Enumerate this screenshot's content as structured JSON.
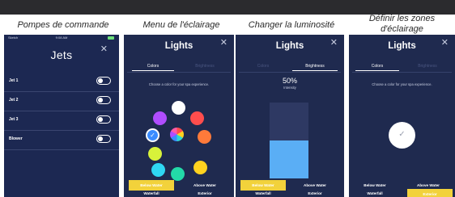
{
  "captions": {
    "jets_pumps": "Pompes de commande",
    "lighting_menu": "Menu de l'éclairage",
    "brightness": "Changer la luminosité",
    "zones": "Définir les zones d'éclairage"
  },
  "jets_screen": {
    "status_carrier": "Sketch",
    "status_time": "9:08 AM",
    "title": "Jets",
    "close_glyph": "✕",
    "items": [
      {
        "label": "Jet 1",
        "on": false
      },
      {
        "label": "Jet 2",
        "on": false
      },
      {
        "label": "Jet 3",
        "on": false
      },
      {
        "label": "Blower",
        "on": false
      }
    ]
  },
  "lights_colors_screen": {
    "title": "Lights",
    "close_glyph": "✕",
    "tabs": [
      "Colors",
      "Brightness"
    ],
    "active_tab": "Colors",
    "hint": "Choose a color for your spa experience.",
    "colors": [
      {
        "name": "white",
        "hex": "#ffffff"
      },
      {
        "name": "purple",
        "hex": "#b04dff"
      },
      {
        "name": "blue",
        "hex": "#3b8cff"
      },
      {
        "name": "color-wheel",
        "hex": "multi"
      },
      {
        "name": "red",
        "hex": "#ff4d4d"
      },
      {
        "name": "yellow-green",
        "hex": "#d8f23a"
      },
      {
        "name": "orange",
        "hex": "#ff7a3a"
      },
      {
        "name": "cyan",
        "hex": "#2fd7f3"
      },
      {
        "name": "teal",
        "hex": "#23d9a8"
      },
      {
        "name": "yellow",
        "hex": "#ffd21f"
      }
    ],
    "selected_color": "blue",
    "check_glyph": "✓",
    "zones": [
      {
        "label": "Below Water",
        "on": true
      },
      {
        "label": "Above Water",
        "on": false
      },
      {
        "label": "Waterfall",
        "on": false
      },
      {
        "label": "Exterior",
        "on": false
      }
    ]
  },
  "lights_brightness_screen": {
    "title": "Lights",
    "close_glyph": "✕",
    "tabs": [
      "Colors",
      "Brightness"
    ],
    "active_tab": "Brightness",
    "intensity_value": "50%",
    "intensity_label": "Intensity",
    "intensity_fraction": 0.5,
    "zones": [
      {
        "label": "Below Water",
        "on": true
      },
      {
        "label": "Above Water",
        "on": false
      },
      {
        "label": "Waterfall",
        "on": false
      },
      {
        "label": "Exterior",
        "on": false
      }
    ]
  },
  "lights_zones_screen": {
    "title": "Lights",
    "close_glyph": "✕",
    "tabs": [
      "Colors",
      "Brightness"
    ],
    "active_tab": "Colors",
    "hint": "Choose a color for your spa experience.",
    "check_glyph": "✓",
    "zones": [
      {
        "label": "Below Water",
        "on": false
      },
      {
        "label": "Above Water",
        "on": false
      },
      {
        "label": "Waterfall",
        "on": false
      },
      {
        "label": "Exterior",
        "on": true
      }
    ]
  },
  "colors": {
    "panel_bg": "#1f2a4f",
    "accent_yellow": "#f2d23b",
    "slider_fill": "#5aaef5"
  }
}
